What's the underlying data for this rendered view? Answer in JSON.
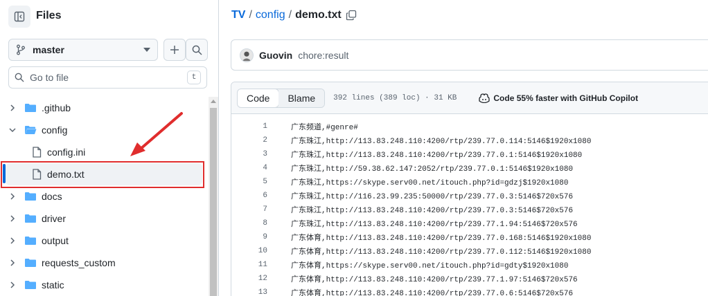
{
  "sidebar": {
    "title": "Files",
    "branch": "master",
    "search_placeholder": "Go to file",
    "search_shortcut": "t",
    "tree": [
      {
        "label": ".github",
        "type": "dir",
        "expanded": false
      },
      {
        "label": "config",
        "type": "dir",
        "expanded": true
      },
      {
        "label": "config.ini",
        "type": "file"
      },
      {
        "label": "demo.txt",
        "type": "file",
        "selected": true
      },
      {
        "label": "docs",
        "type": "dir",
        "expanded": false
      },
      {
        "label": "driver",
        "type": "dir",
        "expanded": false
      },
      {
        "label": "output",
        "type": "dir",
        "expanded": false
      },
      {
        "label": "requests_custom",
        "type": "dir",
        "expanded": false
      },
      {
        "label": "static",
        "type": "dir",
        "expanded": false
      }
    ]
  },
  "breadcrumb": {
    "repo": "TV",
    "sep1": "/",
    "folder": "config",
    "sep2": "/",
    "file": "demo.txt"
  },
  "commit": {
    "author": "Guovin",
    "message": "chore:result"
  },
  "file_header": {
    "tab_code": "Code",
    "tab_blame": "Blame",
    "meta": "392 lines (389 loc) · 31 KB",
    "copilot": "Code 55% faster with GitHub Copilot"
  },
  "code_lines": [
    {
      "n": "1",
      "t": "广东频道,#genre#"
    },
    {
      "n": "2",
      "t": "广东珠江,http://113.83.248.110:4200/rtp/239.77.0.114:5146$1920x1080"
    },
    {
      "n": "3",
      "t": "广东珠江,http://113.83.248.110:4200/rtp/239.77.0.1:5146$1920x1080"
    },
    {
      "n": "4",
      "t": "广东珠江,http://59.38.62.147:2052/rtp/239.77.0.1:5146$1920x1080"
    },
    {
      "n": "5",
      "t": "广东珠江,https://skype.serv00.net/itouch.php?id=gdzj$1920x1080"
    },
    {
      "n": "6",
      "t": "广东珠江,http://116.23.99.235:50000/rtp/239.77.0.3:5146$720x576"
    },
    {
      "n": "7",
      "t": "广东珠江,http://113.83.248.110:4200/rtp/239.77.0.3:5146$720x576"
    },
    {
      "n": "8",
      "t": "广东珠江,http://113.83.248.110:4200/rtp/239.77.1.94:5146$720x576"
    },
    {
      "n": "9",
      "t": "广东体育,http://113.83.248.110:4200/rtp/239.77.0.168:5146$1920x1080"
    },
    {
      "n": "10",
      "t": "广东体育,http://113.83.248.110:4200/rtp/239.77.0.112:5146$1920x1080"
    },
    {
      "n": "11",
      "t": "广东体育,https://skype.serv00.net/itouch.php?id=gdty$1920x1080"
    },
    {
      "n": "12",
      "t": "广东体育,http://113.83.248.110:4200/rtp/239.77.1.97:5146$720x576"
    },
    {
      "n": "13",
      "t": "广东体育,http://113.83.248.110:4200/rtp/239.77.0.6:5146$720x576"
    }
  ],
  "colors": {
    "accent": "#0969da",
    "folder": "#54aeff",
    "annotation": "#e02d2d"
  }
}
